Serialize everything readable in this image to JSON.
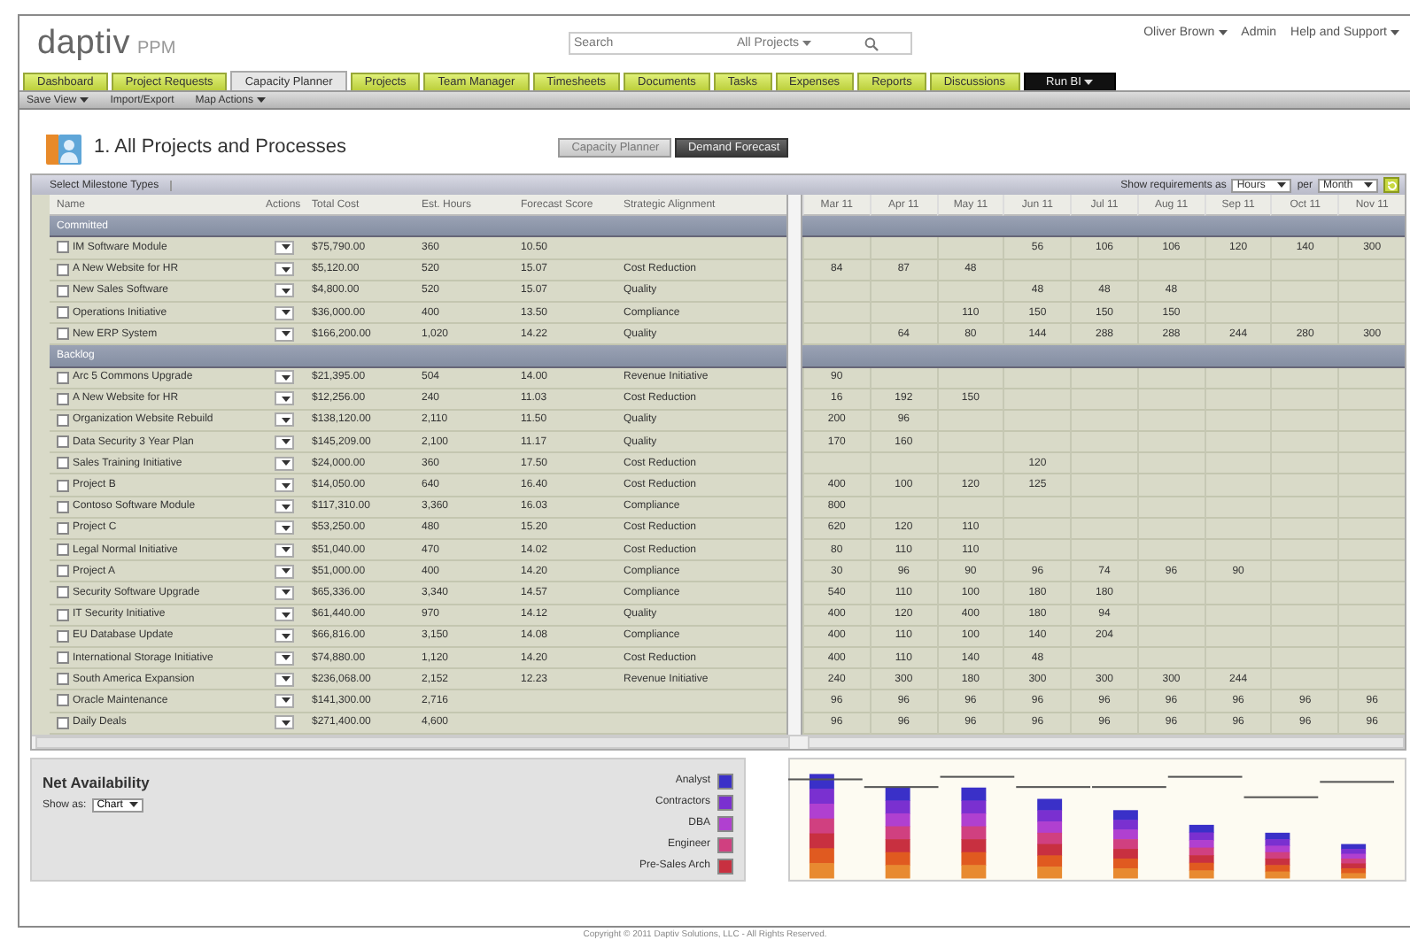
{
  "header": {
    "logo": {
      "brand": "daptiv",
      "product": "PPM"
    },
    "search": {
      "placeholder": "Search",
      "scope": "All Projects"
    },
    "user_links": [
      {
        "label": "Oliver Brown",
        "menu": true
      },
      {
        "label": "Admin",
        "menu": false
      },
      {
        "label": "Help and Support",
        "menu": true
      }
    ]
  },
  "nav_tabs": [
    {
      "label": "Dashboard",
      "selected": false,
      "kind": "tab"
    },
    {
      "label": "Project Requests",
      "selected": false,
      "kind": "tab"
    },
    {
      "label": "Capacity Planner",
      "selected": true,
      "kind": "tab"
    },
    {
      "label": "Projects",
      "selected": false,
      "kind": "tab"
    },
    {
      "label": "Team Manager",
      "selected": false,
      "kind": "tab"
    },
    {
      "label": "Timesheets",
      "selected": false,
      "kind": "tab"
    },
    {
      "label": "Documents",
      "selected": false,
      "kind": "tab"
    },
    {
      "label": "Tasks",
      "selected": false,
      "kind": "tab"
    },
    {
      "label": "Expenses",
      "selected": false,
      "kind": "tab"
    },
    {
      "label": "Reports",
      "selected": false,
      "kind": "tab"
    },
    {
      "label": "Discussions",
      "selected": false,
      "kind": "tab"
    },
    {
      "label": "Run BI",
      "selected": false,
      "kind": "launcher"
    }
  ],
  "sub_menu": [
    {
      "label": "Save View",
      "menu": true
    },
    {
      "label": "Import/Export",
      "menu": false
    },
    {
      "label": "Map Actions",
      "menu": true
    }
  ],
  "page_title": "1. All Projects and Processes",
  "view_toggle": [
    {
      "label": "Capacity Planner",
      "selected": false
    },
    {
      "label": "Demand Forecast",
      "selected": true
    }
  ],
  "toolbar": {
    "title": "Select Milestone Types",
    "show_label": "Show requirements as",
    "unit": "Hours",
    "per_label": "per",
    "period": "Month"
  },
  "table": {
    "columns": [
      "Name",
      "Actions",
      "Total Cost",
      "Est. Hours",
      "Forecast Score",
      "Strategic Alignment"
    ],
    "month_columns": [
      "Mar 11",
      "Apr 11",
      "May 11",
      "Jun 11",
      "Jul 11",
      "Aug 11",
      "Sep 11",
      "Oct 11",
      "Nov 11"
    ],
    "groups": [
      {
        "name": "Committed",
        "rows": [
          {
            "name": "IM Software Module",
            "checked": false,
            "cost": "$75,790.00",
            "hours": "360",
            "score": "10.50",
            "months": {
              "m4": "56",
              "m5": "106",
              "m6": "106",
              "m7": "120",
              "m8": "140",
              "m9": "300"
            }
          },
          {
            "name": "A New Website for HR",
            "checked": false,
            "cost": "$5,120.00",
            "hours": "520",
            "score": "15.07",
            "alignment": "Cost Reduction",
            "months": {
              "m1": "84",
              "m2": "87",
              "m3": "48"
            }
          },
          {
            "name": "New Sales Software",
            "checked": false,
            "cost": "$4,800.00",
            "hours": "520",
            "score": "15.07",
            "alignment": "Quality",
            "months": {
              "m4": "48",
              "m5": "48",
              "m6": "48"
            }
          },
          {
            "name": "Operations Initiative",
            "checked": false,
            "cost": "$36,000.00",
            "hours": "400",
            "score": "13.50",
            "alignment": "Compliance",
            "months": {
              "m3": "110",
              "m4": "150",
              "m5": "150",
              "m6": "150"
            }
          },
          {
            "name": "New ERP System",
            "checked": false,
            "cost": "$166,200.00",
            "hours": "1,020",
            "score": "14.22",
            "alignment": "Quality",
            "months": {
              "m2": "64",
              "m3": "80",
              "m4": "144",
              "m5": "288",
              "m6": "288",
              "m7": "244",
              "m8": "280",
              "m9": "300"
            }
          }
        ]
      },
      {
        "name": "Backlog",
        "rows": [
          {
            "name": "Arc 5 Commons Upgrade",
            "checked": false,
            "cost": "$21,395.00",
            "hours": "504",
            "score": "14.00",
            "alignment": "Revenue Initiative",
            "months": {
              "m1": "90"
            }
          },
          {
            "name": "A New Website for HR",
            "checked": false,
            "cost": "$12,256.00",
            "hours": "240",
            "score": "11.03",
            "alignment": "Cost Reduction",
            "months": {
              "m1": "16",
              "m2": "192",
              "m3": "150"
            }
          },
          {
            "name": "Organization Website Rebuild",
            "checked": false,
            "cost": "$138,120.00",
            "hours": "2,110",
            "score": "11.50",
            "alignment": "Quality",
            "months": {
              "m1": "200",
              "m2": "96"
            }
          },
          {
            "name": "Data Security 3 Year Plan",
            "checked": false,
            "cost": "$145,209.00",
            "hours": "2,100",
            "score": "11.17",
            "alignment": "Quality",
            "months": {
              "m1": "170",
              "m2": "160"
            }
          },
          {
            "name": "Sales Training Initiative",
            "checked": false,
            "cost": "$24,000.00",
            "hours": "360",
            "score": "17.50",
            "alignment": "Cost Reduction",
            "months": {
              "m4": "120"
            }
          },
          {
            "name": "Project B",
            "checked": false,
            "cost": "$14,050.00",
            "hours": "640",
            "score": "16.40",
            "alignment": "Cost Reduction",
            "months": {
              "m1": "400",
              "m2": "100",
              "m3": "120",
              "m4": "125"
            }
          },
          {
            "name": "Contoso Software Module",
            "checked": false,
            "cost": "$117,310.00",
            "hours": "3,360",
            "score": "16.03",
            "alignment": "Compliance",
            "months": {
              "m1": "800"
            }
          },
          {
            "name": "Project C",
            "checked": false,
            "cost": "$53,250.00",
            "hours": "480",
            "score": "15.20",
            "alignment": "Cost Reduction",
            "months": {
              "m1": "620",
              "m2": "120",
              "m3": "110"
            }
          },
          {
            "name": "Legal Normal Initiative",
            "checked": false,
            "cost": "$51,040.00",
            "hours": "470",
            "score": "14.02",
            "alignment": "Cost Reduction",
            "months": {
              "m1": "80",
              "m2": "110",
              "m3": "110"
            }
          },
          {
            "name": "Project A",
            "checked": false,
            "cost": "$51,000.00",
            "hours": "400",
            "score": "14.20",
            "alignment": "Compliance",
            "months": {
              "m1": "30",
              "m2": "96",
              "m3": "90",
              "m4": "96",
              "m5": "74",
              "m6": "96",
              "m7": "90"
            }
          },
          {
            "name": "Security Software Upgrade",
            "checked": false,
            "cost": "$65,336.00",
            "hours": "3,340",
            "score": "14.57",
            "alignment": "Compliance",
            "months": {
              "m1": "540",
              "m2": "110",
              "m3": "100",
              "m4": "180",
              "m5": "180"
            }
          },
          {
            "name": "IT Security Initiative",
            "checked": false,
            "cost": "$61,440.00",
            "hours": "970",
            "score": "14.12",
            "alignment": "Quality",
            "months": {
              "m1": "400",
              "m2": "120",
              "m3": "400",
              "m4": "180",
              "m5": "94"
            }
          },
          {
            "name": "EU Database Update",
            "checked": false,
            "cost": "$66,816.00",
            "hours": "3,150",
            "score": "14.08",
            "alignment": "Compliance",
            "months": {
              "m1": "400",
              "m2": "110",
              "m3": "100",
              "m4": "140",
              "m5": "204"
            }
          },
          {
            "name": "International Storage Initiative",
            "checked": false,
            "cost": "$74,880.00",
            "hours": "1,120",
            "score": "14.20",
            "alignment": "Cost Reduction",
            "months": {
              "m1": "400",
              "m2": "110",
              "m3": "140",
              "m4": "48"
            }
          },
          {
            "name": "South America Expansion",
            "checked": false,
            "cost": "$236,068.00",
            "hours": "2,152",
            "score": "12.23",
            "alignment": "Revenue Initiative",
            "months": {
              "m1": "240",
              "m2": "300",
              "m3": "180",
              "m4": "300",
              "m5": "300",
              "m6": "300",
              "m7": "244"
            }
          },
          {
            "name": "Oracle Maintenance",
            "checked": false,
            "cost": "$141,300.00",
            "hours": "2,716",
            "months": {
              "m1": "96",
              "m2": "96",
              "m3": "96",
              "m4": "96",
              "m5": "96",
              "m6": "96",
              "m7": "96",
              "m8": "96",
              "m9": "96"
            }
          },
          {
            "name": "Daily Deals",
            "checked": false,
            "cost": "$271,400.00",
            "hours": "4,600",
            "months": {
              "m1": "96",
              "m2": "96",
              "m3": "96",
              "m4": "96",
              "m5": "96",
              "m6": "96",
              "m7": "96",
              "m8": "96",
              "m9": "96"
            }
          }
        ]
      }
    ]
  },
  "net_availability": {
    "title": "Net Availability",
    "show_label": "Show as:",
    "show_value": "Chart",
    "legend": [
      {
        "label": "Analyst",
        "color": "#3a30c8"
      },
      {
        "label": "Contractors",
        "color": "#7a30d0"
      },
      {
        "label": "DBA",
        "color": "#b040d0"
      },
      {
        "label": "Engineer",
        "color": "#d04080"
      },
      {
        "label": "Pre-Sales Arch",
        "color": "#c83040"
      }
    ]
  },
  "footer": "Copyright © 2011 Daptiv Solutions, LLC - All Rights Reserved."
}
